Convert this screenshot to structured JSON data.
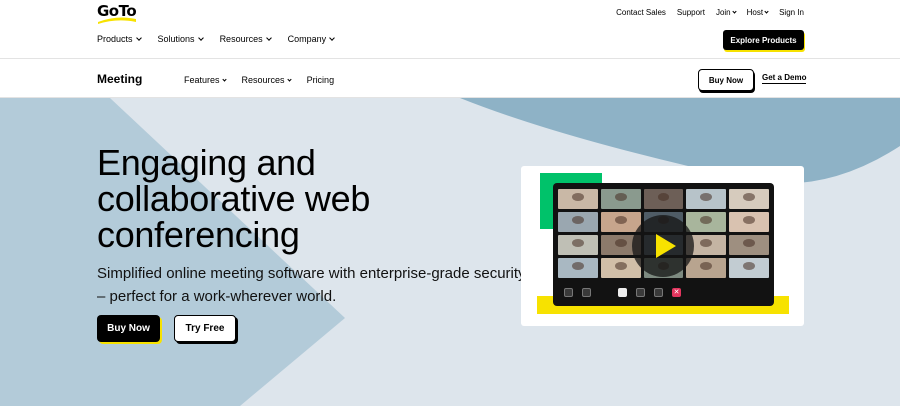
{
  "brand": {
    "logo_text": "GoTo",
    "accent_yellow": "#f7e200",
    "accent_green": "#00c26a",
    "hero_bg": "#dde5ec",
    "shape_blue": "#8eb2c6"
  },
  "utility_nav": {
    "items": [
      {
        "label": "Contact Sales",
        "has_dropdown": false
      },
      {
        "label": "Support",
        "has_dropdown": false
      },
      {
        "label": "Join",
        "has_dropdown": true
      },
      {
        "label": "Host",
        "has_dropdown": true
      },
      {
        "label": "Sign In",
        "has_dropdown": false
      }
    ]
  },
  "main_nav": {
    "items": [
      {
        "label": "Products"
      },
      {
        "label": "Solutions"
      },
      {
        "label": "Resources"
      },
      {
        "label": "Company"
      }
    ],
    "cta_label": "Explore Products"
  },
  "product_nav": {
    "product_name": "Meeting",
    "items": [
      {
        "label": "Features",
        "has_dropdown": true
      },
      {
        "label": "Resources",
        "has_dropdown": true
      },
      {
        "label": "Pricing",
        "has_dropdown": false
      }
    ],
    "buy_label": "Buy Now",
    "demo_label": "Get a Demo"
  },
  "hero": {
    "headline": "Engaging and collaborative web conferencing",
    "subtext": "Simplified online meeting software with enterprise-grade security – perfect for a work-wherever world.",
    "buy_label": "Buy Now",
    "try_label": "Try Free"
  },
  "media": {
    "play_icon": "play-icon",
    "end_call_glyph": "✕"
  }
}
